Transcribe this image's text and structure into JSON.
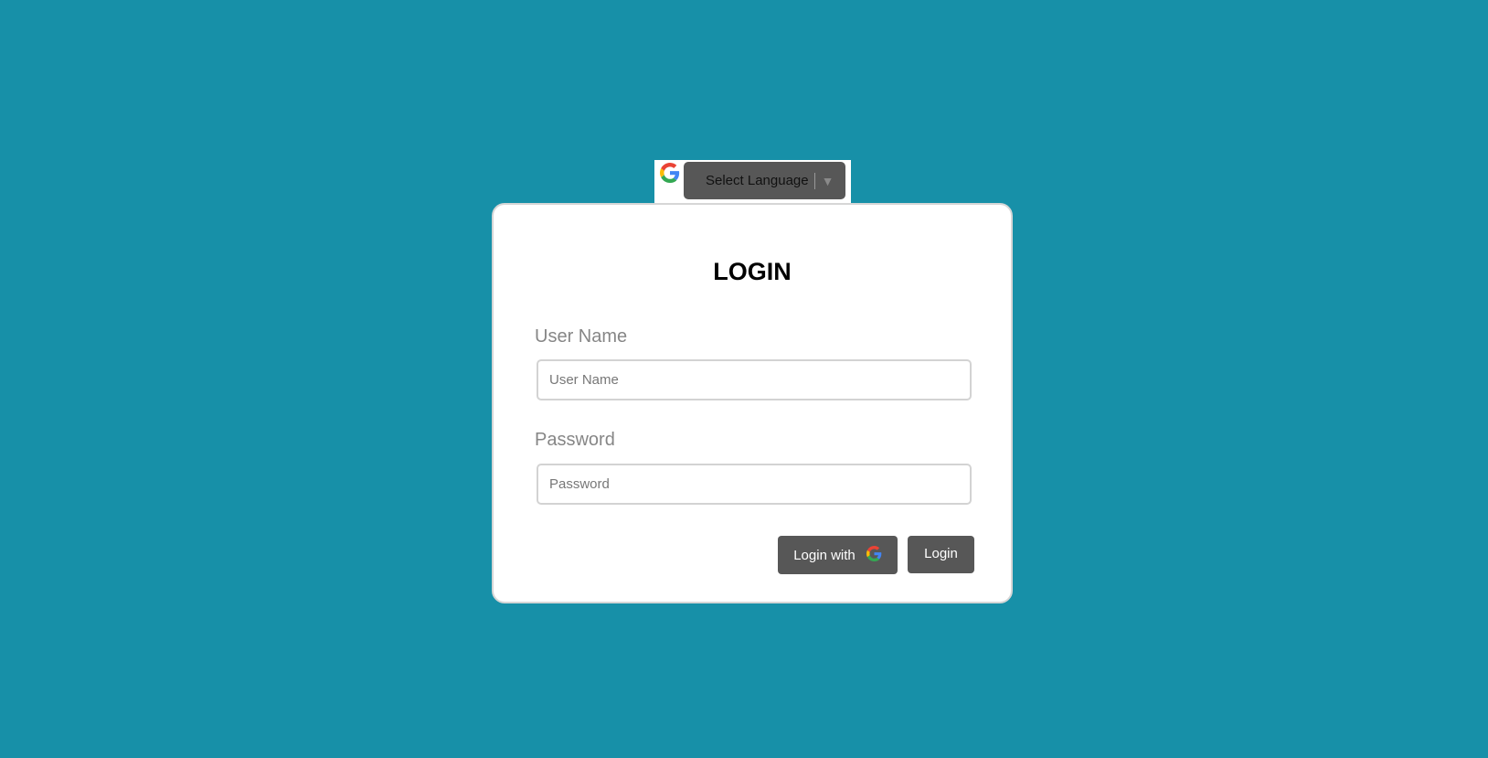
{
  "language": {
    "select_label": "Select Language",
    "arrow": "▼",
    "icon": "google-g-icon"
  },
  "login": {
    "title": "LOGIN",
    "username_label": "User Name",
    "username_placeholder": "User Name",
    "username_value": "",
    "password_label": "Password",
    "password_placeholder": "Password",
    "password_value": "",
    "google_button_label": "Login with",
    "login_button_label": "Login"
  },
  "colors": {
    "background": "#1790a8",
    "button": "#575757"
  }
}
